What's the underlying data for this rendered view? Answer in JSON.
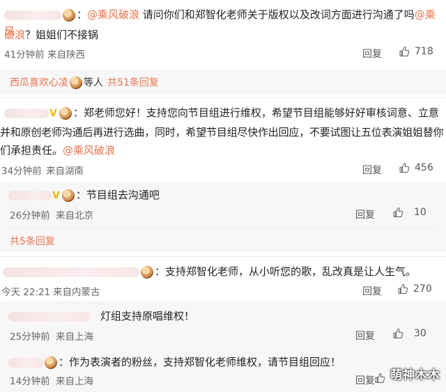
{
  "comments": [
    {
      "text": "：@乘风破浪 请问你们和郑智化老师关于版权以及改词方面进行沟通了吗@乘风破浪？姐姐们不接锅",
      "part_a": "：",
      "mention1": "@乘风破浪",
      "part_b": " 请问你们和郑智化老师关于版权以及改词方面进行沟通了吗",
      "mention2": "@乘风",
      "line2_mention": "破浪",
      "line2_rest": "？姐姐们不接锅",
      "time": "41分钟前",
      "location": "来自陕西",
      "reply_label": "回复",
      "likes": "718"
    },
    {
      "text": "：郑老师您好！支持您向节目组进行维权，希望节目组能够好好审核词意、立意并和原创老师沟通后再进行选曲，同时，希望节目组尽快作出回应，不要试图让五位表演姐姐替你们承担责任。@乘风破浪",
      "line1": "：郑老师您好！支持您向节目组进行维权，希望节目组能够好好审核词意、立意",
      "line2": "并和原创老师沟通后再进行选曲，同时，希望节目组尽快作出回应，不要试图让五位表演姐姐替你",
      "line3": "们承担责任。",
      "mention": "@乘风破浪",
      "time": "34分钟前",
      "location": "来自湖南",
      "reply_label": "回复",
      "likes": "456"
    },
    {
      "text": "：支持郑智化老师，从小听您的歌，乱改真是让人生气。",
      "time": "今天 22:21",
      "location": "来自内蒙古",
      "reply_label": "回复",
      "likes": "270"
    }
  ],
  "thread1": {
    "summary_name": "西瓜喜欢心凌",
    "summary_mid": "等人",
    "summary_count": "共51条回复"
  },
  "thread2": {
    "reply": {
      "text": "：节目组去沟通吧",
      "time": "26分钟前",
      "location": "来自北京",
      "reply_label": "回复",
      "likes": "10"
    },
    "more": "共5条回复"
  },
  "thread3": {
    "replies": [
      {
        "text": "灯组支持原唱维权！",
        "time": "25分钟前",
        "location": "来自上海",
        "reply_label": "回复",
        "likes": "30"
      },
      {
        "text": "：作为表演者的粉丝，支持郑智化老师维权，请节目组回应！",
        "time": "14分钟前",
        "location": "来自上海",
        "reply_label": "回复",
        "likes": ""
      }
    ]
  },
  "watermark": "萌神木木",
  "colors": {
    "accent": "#eb7350",
    "badge": "#f4b400",
    "subbg": "#f7f7f7"
  },
  "icons": [
    "thumbs-up-icon",
    "avatar",
    "vip-badge-icon"
  ]
}
